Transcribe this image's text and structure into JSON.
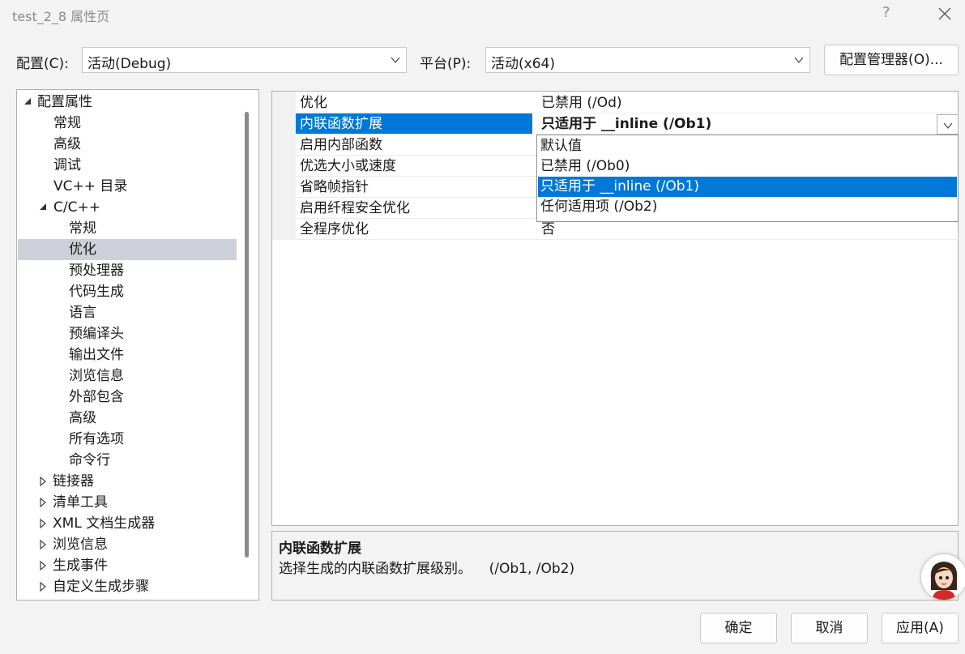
{
  "window": {
    "title": "test_2_8 属性页",
    "help_label": "?"
  },
  "config": {
    "config_label": "配置(C):",
    "config_value": "活动(Debug)",
    "platform_label": "平台(P):",
    "platform_value": "活动(x64)",
    "manager_button": "配置管理器(O)..."
  },
  "tree": {
    "items": [
      {
        "label": "配置属性",
        "twisty": "expanded"
      },
      {
        "label": "常规"
      },
      {
        "label": "高级"
      },
      {
        "label": "调试"
      },
      {
        "label": "VC++ 目录"
      },
      {
        "label": "C/C++",
        "twisty": "expanded"
      },
      {
        "label": "常规"
      },
      {
        "label": "优化",
        "selected": true
      },
      {
        "label": "预处理器"
      },
      {
        "label": "代码生成"
      },
      {
        "label": "语言"
      },
      {
        "label": "预编译头"
      },
      {
        "label": "输出文件"
      },
      {
        "label": "浏览信息"
      },
      {
        "label": "外部包含"
      },
      {
        "label": "高级"
      },
      {
        "label": "所有选项"
      },
      {
        "label": "命令行"
      },
      {
        "label": "链接器",
        "twisty": "collapsed"
      },
      {
        "label": "清单工具",
        "twisty": "collapsed"
      },
      {
        "label": "XML 文档生成器",
        "twisty": "collapsed"
      },
      {
        "label": "浏览信息",
        "twisty": "collapsed"
      },
      {
        "label": "生成事件",
        "twisty": "collapsed"
      },
      {
        "label": "自定义生成步骤",
        "twisty": "collapsed"
      }
    ]
  },
  "grid": {
    "rows": [
      {
        "name": "优化",
        "value": "已禁用 (/Od)"
      },
      {
        "name": "内联函数扩展",
        "value": "只适用于 __inline (/Ob1)",
        "selected": true
      },
      {
        "name": "启用内部函数",
        "value": ""
      },
      {
        "name": "优选大小或速度",
        "value": ""
      },
      {
        "name": "省略帧指针",
        "value": ""
      },
      {
        "name": "启用纤程安全优化",
        "value": ""
      },
      {
        "name": "全程序优化",
        "value": "否"
      }
    ],
    "dropdown_options": [
      "默认值",
      "已禁用 (/Ob0)",
      "只适用于 __inline (/Ob1)",
      "任何适用项 (/Ob2)"
    ],
    "dropdown_highlighted": "只适用于 __inline (/Ob1)"
  },
  "description": {
    "title": "内联函数扩展",
    "text": "选择生成的内联函数扩展级别。    (/Ob1, /Ob2)"
  },
  "buttons": {
    "ok": "确定",
    "cancel": "取消",
    "apply": "应用(A)"
  },
  "colors": {
    "selection_blue": "#0078d7",
    "tree_selection": "#cdd0d9"
  }
}
